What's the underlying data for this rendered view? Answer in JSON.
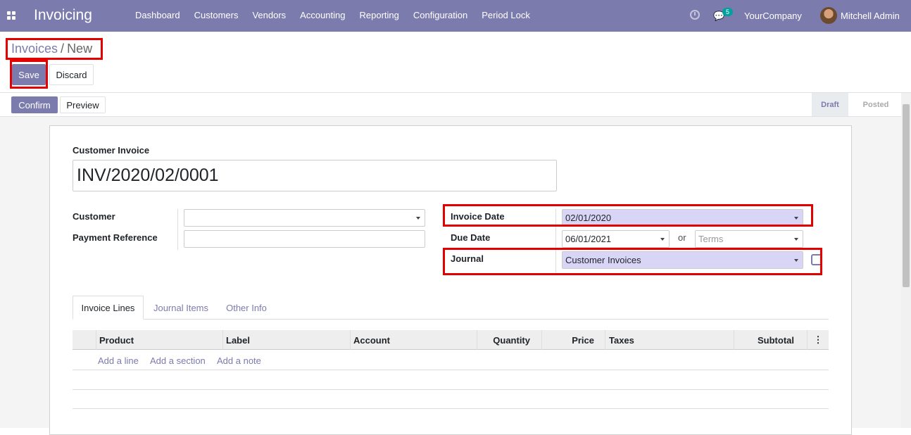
{
  "topbar": {
    "app": "Invoicing",
    "menu": [
      "Dashboard",
      "Customers",
      "Vendors",
      "Accounting",
      "Reporting",
      "Configuration",
      "Period Lock"
    ],
    "chat_count": "5",
    "company": "YourCompany",
    "user": "Mitchell Admin"
  },
  "breadcrumb": {
    "parent": "Invoices",
    "sep": "/",
    "current": "New"
  },
  "buttons": {
    "save": "Save",
    "discard": "Discard",
    "confirm": "Confirm",
    "preview": "Preview"
  },
  "stages": {
    "draft": "Draft",
    "posted": "Posted"
  },
  "form": {
    "doc_label": "Customer Invoice",
    "doc_name": "INV/2020/02/0001",
    "customer_label": "Customer",
    "customer_value": "",
    "payref_label": "Payment Reference",
    "payref_value": "",
    "invdate_label": "Invoice Date",
    "invdate_value": "02/01/2020",
    "duedate_label": "Due Date",
    "duedate_value": "06/01/2021",
    "or": "or",
    "terms_placeholder": "Terms",
    "journal_label": "Journal",
    "journal_value": "Customer Invoices"
  },
  "tabs": [
    "Invoice Lines",
    "Journal Items",
    "Other Info"
  ],
  "columns": [
    "Product",
    "Label",
    "Account",
    "Quantity",
    "Price",
    "Taxes",
    "Subtotal"
  ],
  "links": [
    "Add a line",
    "Add a section",
    "Add a note"
  ]
}
